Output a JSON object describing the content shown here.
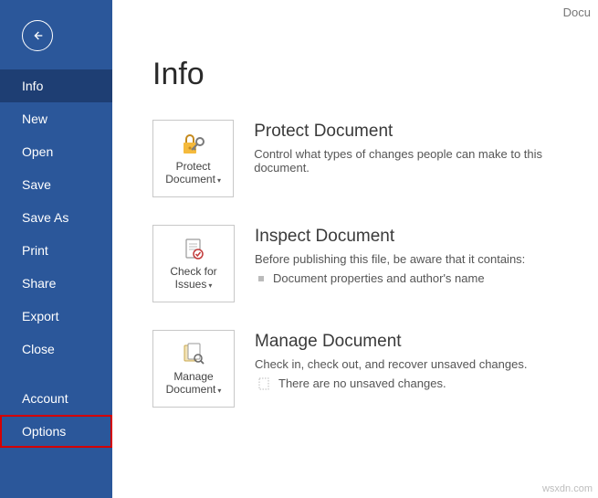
{
  "titlebar": {
    "docLabel": "Docu"
  },
  "sidebar": {
    "items": [
      {
        "label": "Info",
        "selected": true
      },
      {
        "label": "New"
      },
      {
        "label": "Open"
      },
      {
        "label": "Save"
      },
      {
        "label": "Save As"
      },
      {
        "label": "Print"
      },
      {
        "label": "Share"
      },
      {
        "label": "Export"
      },
      {
        "label": "Close"
      }
    ],
    "lowerItems": [
      {
        "label": "Account"
      },
      {
        "label": "Options",
        "highlighted": true
      }
    ]
  },
  "page": {
    "title": "Info"
  },
  "sections": {
    "protect": {
      "tileLabel": "Protect Document",
      "title": "Protect Document",
      "desc": "Control what types of changes people can make to this document."
    },
    "inspect": {
      "tileLabel": "Check for Issues",
      "title": "Inspect Document",
      "desc": "Before publishing this file, be aware that it contains:",
      "bullet": "Document properties and author's name"
    },
    "manage": {
      "tileLabel": "Manage Document",
      "title": "Manage Document",
      "desc": "Check in, check out, and recover unsaved changes.",
      "status": "There are no unsaved changes."
    }
  },
  "watermark": "wsxdn.com"
}
